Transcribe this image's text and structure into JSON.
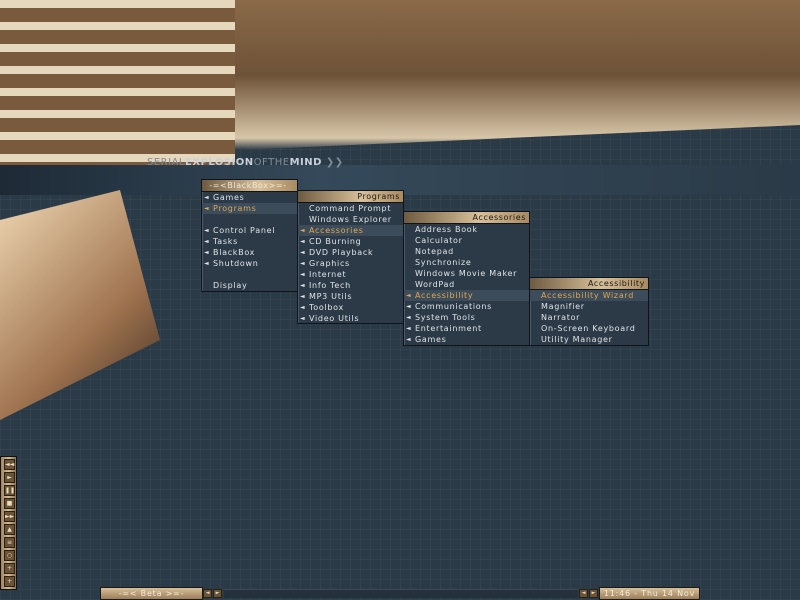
{
  "wallpaper": {
    "logo_a": "SERIAL",
    "logo_b": "EXPLOSION",
    "logo_c": "OFTHE",
    "logo_d": "MIND",
    "logo_e": "❯❯"
  },
  "menus": {
    "root": {
      "title": "-=<BlackBox>=-",
      "items": [
        {
          "label": "Games",
          "sub": true
        },
        {
          "label": "Programs",
          "sub": true,
          "hl": true
        },
        {
          "label": ""
        },
        {
          "label": "Control Panel",
          "sub": true
        },
        {
          "label": "Tasks",
          "sub": true
        },
        {
          "label": "BlackBox",
          "sub": true
        },
        {
          "label": "Shutdown",
          "sub": true
        },
        {
          "label": ""
        },
        {
          "label": "Display"
        }
      ]
    },
    "programs": {
      "title": "Programs",
      "items": [
        {
          "label": "Command Prompt"
        },
        {
          "label": "Windows Explorer"
        },
        {
          "label": "Accessories",
          "sub": true,
          "hl": true
        },
        {
          "label": "CD Burning",
          "sub": true
        },
        {
          "label": "DVD Playback",
          "sub": true
        },
        {
          "label": "Graphics",
          "sub": true
        },
        {
          "label": "Internet",
          "sub": true
        },
        {
          "label": "Info Tech",
          "sub": true
        },
        {
          "label": "MP3 Utils",
          "sub": true
        },
        {
          "label": "Toolbox",
          "sub": true
        },
        {
          "label": "Video Utils",
          "sub": true
        }
      ]
    },
    "accessories": {
      "title": "Accessories",
      "items": [
        {
          "label": "Address Book"
        },
        {
          "label": "Calculator"
        },
        {
          "label": "Notepad"
        },
        {
          "label": "Synchronize"
        },
        {
          "label": "Windows Movie Maker"
        },
        {
          "label": "WordPad"
        },
        {
          "label": "Accessibility",
          "sub": true,
          "hl": true
        },
        {
          "label": "Communications",
          "sub": true
        },
        {
          "label": "System Tools",
          "sub": true
        },
        {
          "label": "Entertainment",
          "sub": true
        },
        {
          "label": "Games",
          "sub": true
        }
      ]
    },
    "accessibility": {
      "title": "Accessibility",
      "items": [
        {
          "label": "Accessibility Wizard",
          "hl": true
        },
        {
          "label": "Magnifier"
        },
        {
          "label": "Narrator"
        },
        {
          "label": "On-Screen Keyboard"
        },
        {
          "label": "Utility Manager"
        }
      ]
    }
  },
  "media_buttons": [
    {
      "icon": "rewind-icon",
      "glyph": "◄◄"
    },
    {
      "icon": "play-icon",
      "glyph": "►"
    },
    {
      "icon": "pause-icon",
      "glyph": "❚❚"
    },
    {
      "icon": "stop-icon",
      "glyph": "■"
    },
    {
      "icon": "fast-forward-icon",
      "glyph": "►►"
    },
    {
      "icon": "eject-icon",
      "glyph": "▲"
    },
    {
      "icon": "playlist-icon",
      "glyph": "≡"
    },
    {
      "icon": "repeat-icon",
      "glyph": "○"
    },
    {
      "icon": "volume-up-icon",
      "glyph": "+"
    },
    {
      "icon": "volume-down-icon",
      "glyph": "+"
    }
  ],
  "taskbar": {
    "workspace": "-=< Beta >=-",
    "prev": "◄",
    "next": "►",
    "clock": "11:46 - Thu 14 Nov"
  }
}
